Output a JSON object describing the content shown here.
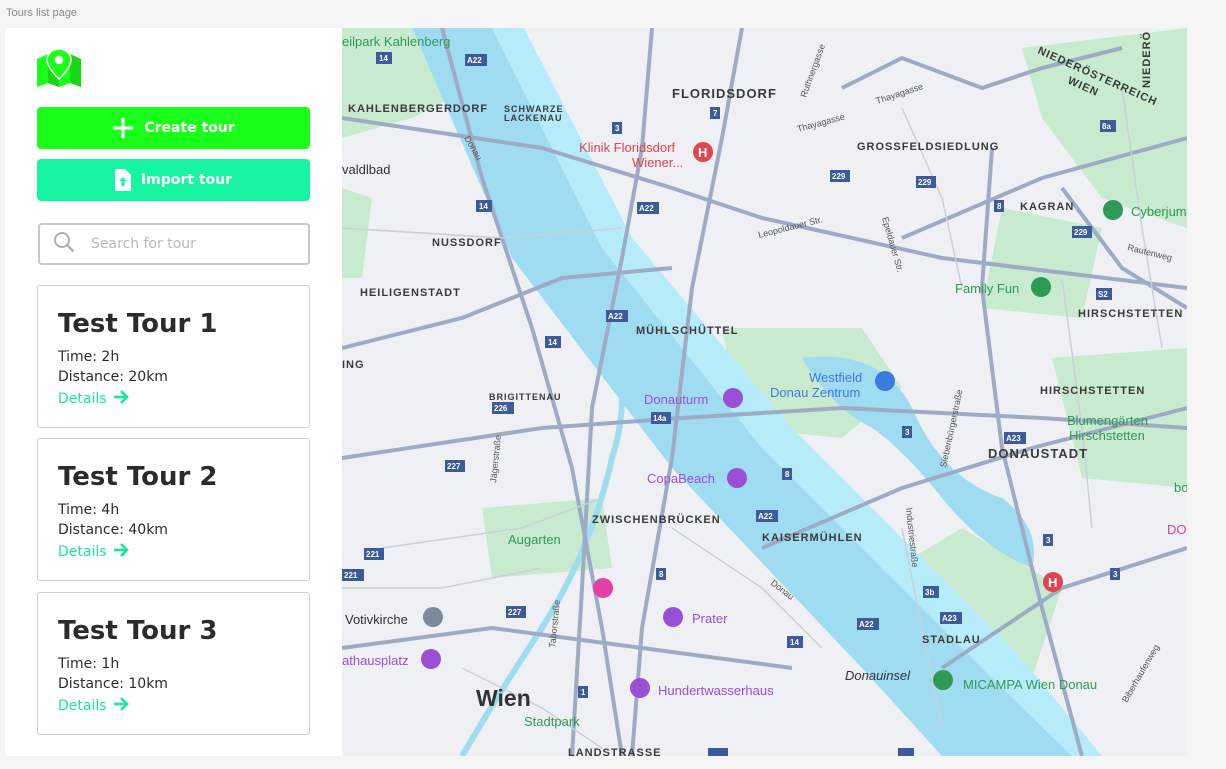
{
  "frame": {
    "label": "Tours list page"
  },
  "buttons": {
    "create": "Create tour",
    "import": "Import tour"
  },
  "search": {
    "placeholder": "Search for tour"
  },
  "tours": [
    {
      "title": "Test Tour 1",
      "time": "Time: 2h",
      "distance": "Distance: 20km",
      "details": "Details"
    },
    {
      "title": "Test Tour 2",
      "time": "Time: 4h",
      "distance": "Distance: 40km",
      "details": "Details"
    },
    {
      "title": "Test Tour 3",
      "time": "Time: 1h",
      "distance": "Distance: 10km",
      "details": "Details"
    }
  ],
  "colors": {
    "primary_green": "#1aff1a",
    "teal": "#17f5a3",
    "link": "#17e89a",
    "water": "#9fdcf2",
    "park": "#c8ebcf"
  },
  "icons": {
    "logo": "map-pin-icon",
    "create": "plus-icon",
    "import": "file-upload-icon",
    "search": "search-icon",
    "details": "arrow-right-icon"
  },
  "map": {
    "districts": [
      "FLORIDSDORF",
      "KAHLENBERGERDORF",
      "SCHWARZE LACKENAU",
      "GROSSFELDSIEDLUNG",
      "KAGRAN",
      "NUSSDORF",
      "HEILIGENSTADT",
      "MÜHLSCHÜTTEL",
      "HIRSCHSTETTEN",
      "BRIGITTENAU",
      "DONAUSTADT",
      "ZWISCHENBRÜCKEN",
      "KAISERMÜHLEN",
      "STADLAU",
      "LANDSTRASSE",
      "NIEDERÖSTERREICH",
      "WIEN",
      "ING"
    ],
    "city": "Wien",
    "pois": [
      "Klinik Floridsdorf",
      "Wiener...",
      "Westfield",
      "Donau Zentrum",
      "Donauturm",
      "CopaBeach",
      "Augarten",
      "Prater",
      "Votivkirche",
      "athausplatz",
      "Hundertwasserhaus",
      "Stadtpark",
      "Donauinsel",
      "MICAMPA Wien Donau",
      "Family Fun",
      "Cyberjum",
      "Blumengärten",
      "Hirschstetten",
      "DORM",
      "bo",
      "eilpark Kahlenberg",
      "valdlbad"
    ],
    "streets": [
      "Thayagasse",
      "Leopoldauer Str.",
      "Rautenweg",
      "Siebenbürgerstraße",
      "Industriestraße",
      "Jägerstraße",
      "Taborstraße",
      "Biberhaufenweg",
      "Donau",
      "Ruthnergasse",
      "Epeldauer Str."
    ],
    "shields": [
      "14",
      "A22",
      "3",
      "7",
      "8a",
      "229",
      "8",
      "3",
      "229",
      "S2",
      "14",
      "A22",
      "14a",
      "226",
      "227",
      "A23",
      "8",
      "221",
      "227",
      "3b",
      "3",
      "221",
      "8",
      "A23",
      "A22",
      "14",
      "1",
      "227",
      "14"
    ]
  }
}
